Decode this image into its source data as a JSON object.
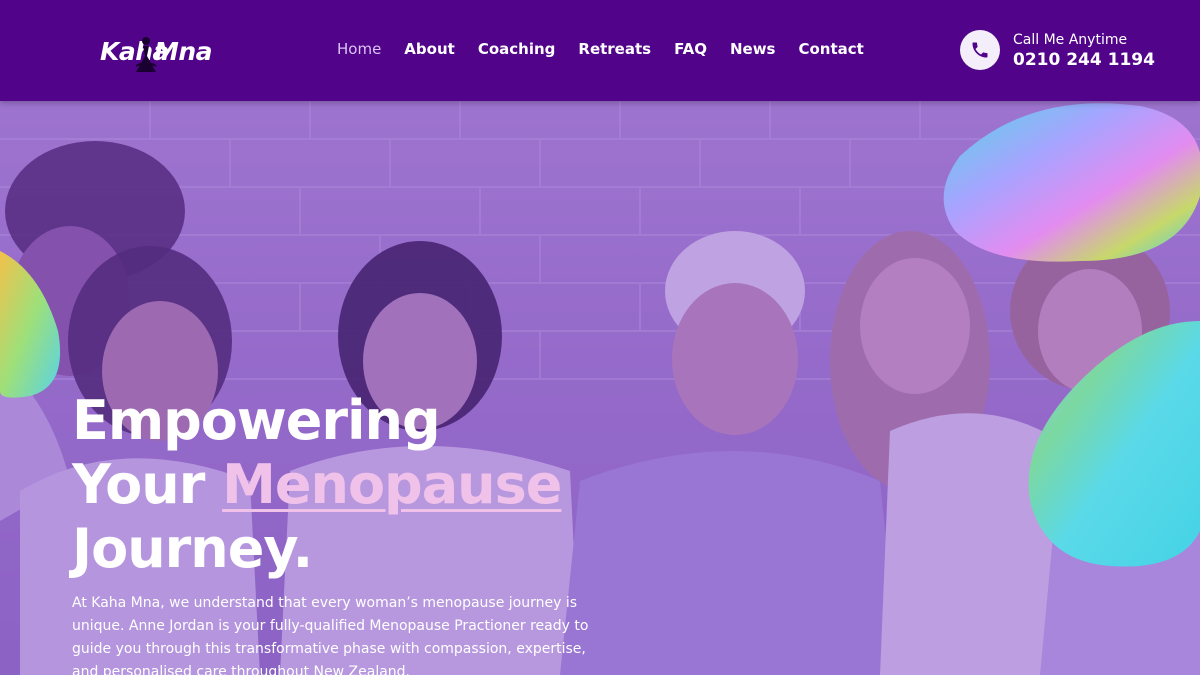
{
  "brand": {
    "logo_word_left": "Kaha",
    "logo_word_right": "Mna",
    "header_color": "#51048a",
    "accent_color": "#f0c2ea"
  },
  "nav": {
    "items": [
      {
        "label": "Home",
        "active": true
      },
      {
        "label": "About",
        "active": false
      },
      {
        "label": "Coaching",
        "active": false
      },
      {
        "label": "Retreats",
        "active": false
      },
      {
        "label": "FAQ",
        "active": false
      },
      {
        "label": "News",
        "active": false
      },
      {
        "label": "Contact",
        "active": false
      }
    ]
  },
  "contact": {
    "icon": "phone-icon",
    "label": "Call Me Anytime",
    "number": "0210 244 1194"
  },
  "hero": {
    "heading_line1": "Empowering",
    "heading_line2_prefix": "Your",
    "heading_highlight": "Menopause",
    "heading_line3": "Journey.",
    "body": "At Kaha Mna, we understand that every woman’s menopause journey is unique. Anne Jordan is your fully-qualified Menopause Practioner ready to guide you through this transformative phase with compassion, expertise, and personalised care throughout New Zealand."
  }
}
